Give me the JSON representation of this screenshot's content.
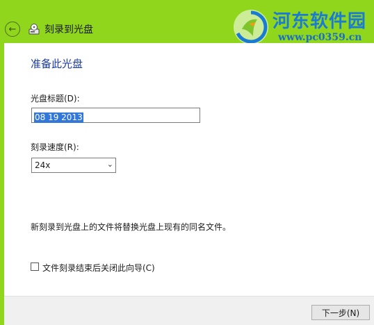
{
  "window": {
    "title": "刻录到光盘",
    "back_icon": "back-arrow-icon",
    "disc_icon": "disc-burn-icon"
  },
  "watermark": {
    "name": "河东软件园",
    "url": "www.pc0359.cn"
  },
  "main": {
    "heading": "准备此光盘",
    "disc_title_label": "光盘标题(D):",
    "disc_title_value": "08 19 2013",
    "speed_label": "刻录速度(R):",
    "speed_value": "24x",
    "info_text": "新刻录到光盘上的文件将替换光盘上现有的同名文件。",
    "close_wizard_checkbox": {
      "label": "文件刻录结束后关闭此向导(C)",
      "checked": false
    }
  },
  "footer": {
    "next_label": "下一步(N)"
  },
  "colors": {
    "titlebar": "#8fd61c",
    "heading": "#1a3aa3",
    "selection": "#3377d9",
    "watermark": "#1a7bd4"
  }
}
